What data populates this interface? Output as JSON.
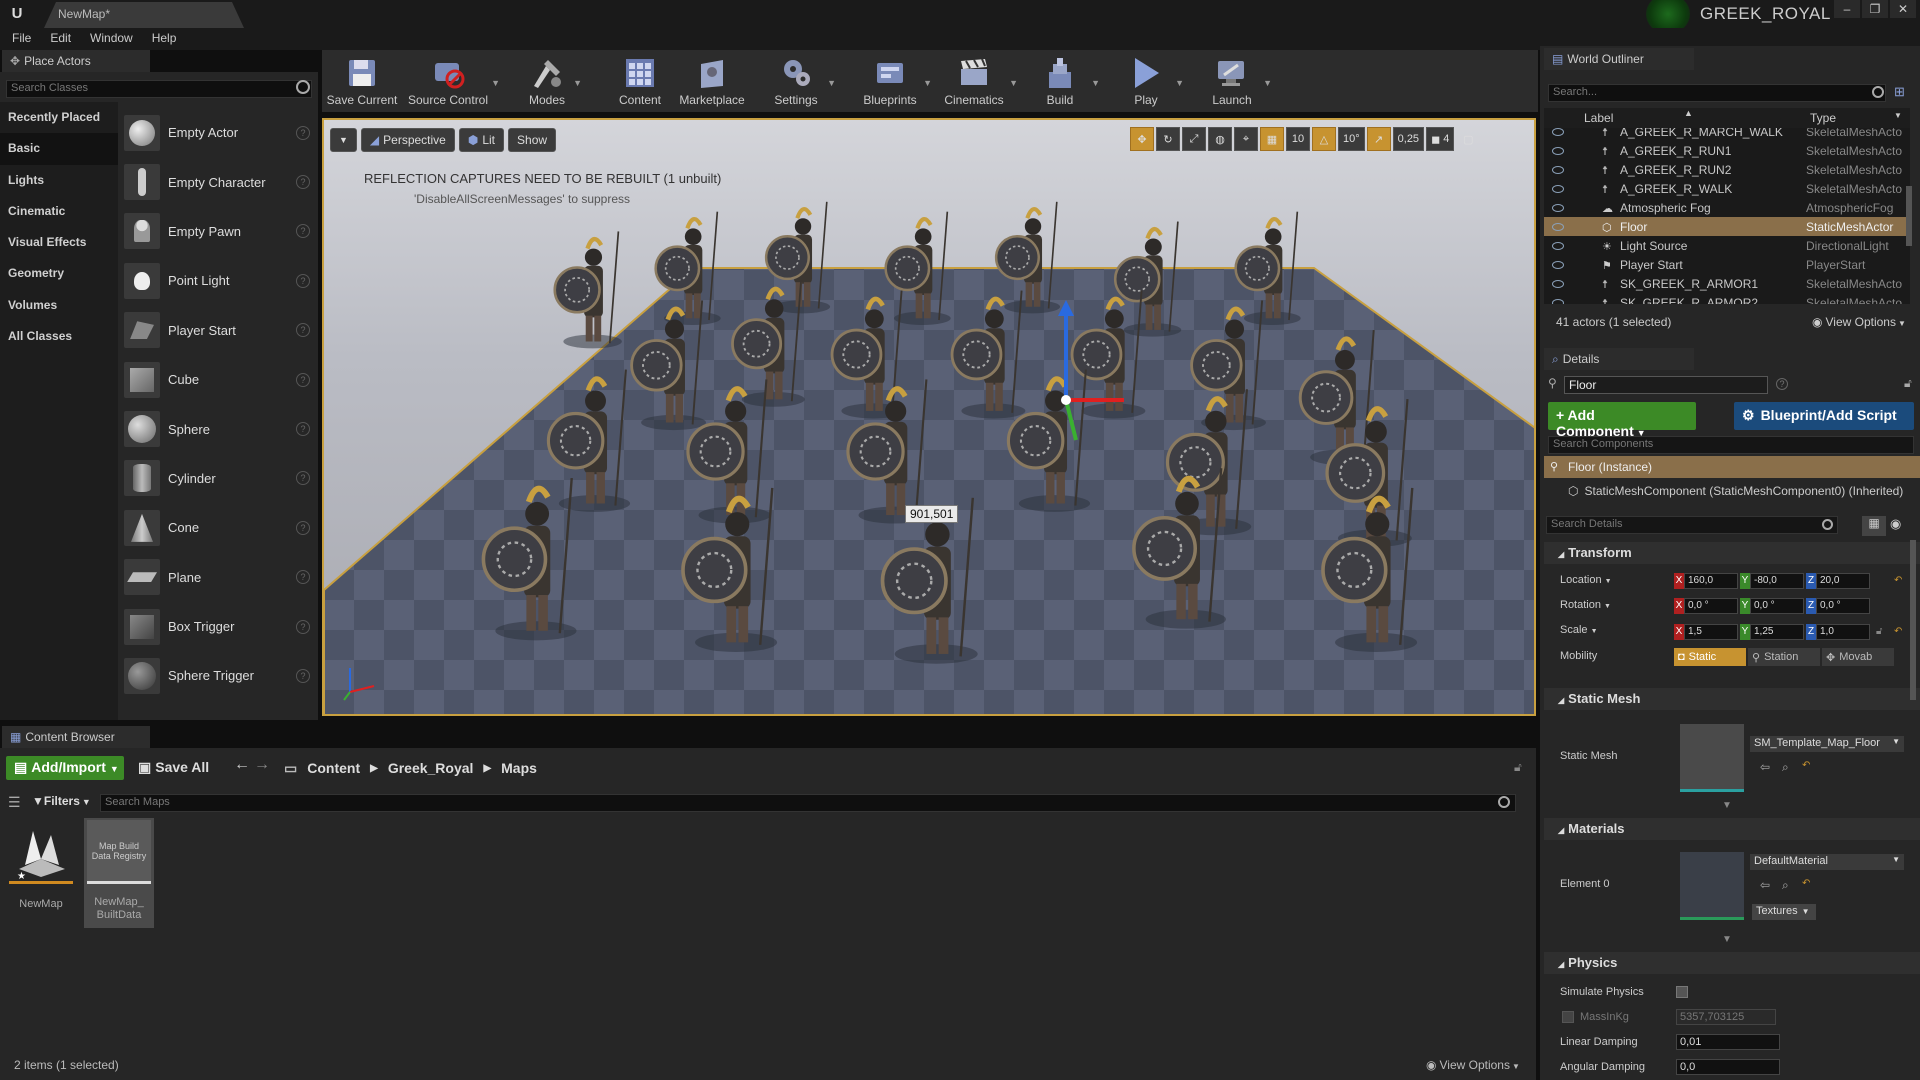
{
  "window": {
    "doc_tab": "NewMap*",
    "project_name": "GREEK_ROYAL",
    "buttons": [
      "‒",
      "❐",
      "✕"
    ]
  },
  "menu": [
    "File",
    "Edit",
    "Window",
    "Help"
  ],
  "place_actors": {
    "tab_title": "Place Actors",
    "search_placeholder": "Search Classes",
    "categories": [
      {
        "label": "Recently Placed",
        "selected": false
      },
      {
        "label": "Basic",
        "selected": true
      },
      {
        "label": "Lights",
        "selected": false
      },
      {
        "label": "Cinematic",
        "selected": false
      },
      {
        "label": "Visual Effects",
        "selected": false
      },
      {
        "label": "Geometry",
        "selected": false
      },
      {
        "label": "Volumes",
        "selected": false
      },
      {
        "label": "All Classes",
        "selected": false
      }
    ],
    "actors": [
      {
        "label": "Empty Actor",
        "icon": "sphere-icon"
      },
      {
        "label": "Empty Character",
        "icon": "character-icon"
      },
      {
        "label": "Empty Pawn",
        "icon": "pawn-icon"
      },
      {
        "label": "Point Light",
        "icon": "light-bulb-icon"
      },
      {
        "label": "Player Start",
        "icon": "player-start-icon"
      },
      {
        "label": "Cube",
        "icon": "cube-icon"
      },
      {
        "label": "Sphere",
        "icon": "sphere-icon"
      },
      {
        "label": "Cylinder",
        "icon": "cylinder-icon"
      },
      {
        "label": "Cone",
        "icon": "cone-icon"
      },
      {
        "label": "Plane",
        "icon": "plane-icon"
      },
      {
        "label": "Box Trigger",
        "icon": "box-trigger-icon"
      },
      {
        "label": "Sphere Trigger",
        "icon": "sphere-trigger-icon"
      }
    ]
  },
  "toolbar": [
    {
      "label": "Save Current",
      "icon": "save-icon",
      "caret": false
    },
    {
      "label": "Source Control",
      "icon": "source-control-icon",
      "caret": true
    },
    {
      "label": "Modes",
      "icon": "modes-icon",
      "caret": true
    },
    {
      "label": "Content",
      "icon": "content-icon",
      "caret": false
    },
    {
      "label": "Marketplace",
      "icon": "marketplace-icon",
      "caret": false
    },
    {
      "label": "Settings",
      "icon": "settings-icon",
      "caret": true
    },
    {
      "label": "Blueprints",
      "icon": "blueprints-icon",
      "caret": true
    },
    {
      "label": "Cinematics",
      "icon": "cinematics-icon",
      "caret": true
    },
    {
      "label": "Build",
      "icon": "build-icon",
      "caret": true
    },
    {
      "label": "Play",
      "icon": "play-icon",
      "caret": true
    },
    {
      "label": "Launch",
      "icon": "launch-icon",
      "caret": true
    }
  ],
  "viewport": {
    "perspective": "Perspective",
    "lit": "Lit",
    "show": "Show",
    "grid_snap": "10",
    "rot_snap": "10°",
    "scale_snap": "0,25",
    "camera_speed": "4",
    "warning": "REFLECTION CAPTURES NEED TO BE REBUILT (1 unbuilt)",
    "warning_hint": "'DisableAllScreenMessages' to suppress",
    "coord_tag": "901,501"
  },
  "content_browser": {
    "tab_title": "Content Browser",
    "add_import": "Add/Import",
    "save_all": "Save All",
    "path": [
      "Content",
      "Greek_Royal",
      "Maps"
    ],
    "filters": "Filters",
    "search_placeholder": "Search Maps",
    "assets": [
      {
        "name": "NewMap",
        "thumb_label": "",
        "selected": false
      },
      {
        "name": "NewMap_\nBuiltData",
        "thumb_label": "Map Build Data Registry",
        "selected": true
      }
    ],
    "status": "2 items (1 selected)",
    "view_options": "View Options"
  },
  "world_outliner": {
    "tab_title": "World Outliner",
    "search_placeholder": "Search...",
    "col_label": "Label",
    "col_type": "Type",
    "rows": [
      {
        "label": "A_GREEK_R_MARCH_WALK",
        "type": "SkeletalMeshActo",
        "selected": false
      },
      {
        "label": "A_GREEK_R_RUN1",
        "type": "SkeletalMeshActo",
        "selected": false
      },
      {
        "label": "A_GREEK_R_RUN2",
        "type": "SkeletalMeshActo",
        "selected": false
      },
      {
        "label": "A_GREEK_R_WALK",
        "type": "SkeletalMeshActo",
        "selected": false
      },
      {
        "label": "Atmospheric Fog",
        "type": "AtmosphericFog",
        "selected": false
      },
      {
        "label": "Floor",
        "type": "StaticMeshActor",
        "selected": true
      },
      {
        "label": "Light Source",
        "type": "DirectionalLight",
        "selected": false
      },
      {
        "label": "Player Start",
        "type": "PlayerStart",
        "selected": false
      },
      {
        "label": "SK_GREEK_R_ARMOR1",
        "type": "SkeletalMeshActo",
        "selected": false
      },
      {
        "label": "SK_GREEK_R_ARMOR2",
        "type": "SkeletalMeshActo",
        "selected": false
      }
    ],
    "count": "41 actors (1 selected)",
    "view_options": "View Options"
  },
  "details": {
    "tab_title": "Details",
    "name": "Floor",
    "add_component": "Add Component",
    "blueprint_script": "Blueprint/Add Script",
    "search_components": "Search Components",
    "instance": "Floor (Instance)",
    "mesh_component": "StaticMeshComponent (StaticMeshComponent0) (Inherited)",
    "search_details": "Search Details",
    "transform": {
      "title": "Transform",
      "location_label": "Location",
      "rotation_label": "Rotation",
      "scale_label": "Scale",
      "mobility_label": "Mobility",
      "location": [
        "160,0",
        "-80,0",
        "20,0"
      ],
      "rotation": [
        "0,0 °",
        "0,0 °",
        "0,0 °"
      ],
      "scale": [
        "1,5",
        "1,25",
        "1,0"
      ],
      "mobility": [
        "Static",
        "Station",
        "Movab"
      ]
    },
    "static_mesh": {
      "title": "Static Mesh",
      "label": "Static Mesh",
      "value": "SM_Template_Map_Floor"
    },
    "materials": {
      "title": "Materials",
      "label": "Element 0",
      "value": "DefaultMaterial",
      "textures": "Textures"
    },
    "physics": {
      "title": "Physics",
      "simulate_label": "Simulate Physics",
      "mass_label": "MassInKg",
      "mass_value": "5357,703125",
      "linear_label": "Linear Damping",
      "linear_value": "0,01",
      "angular_label": "Angular Damping",
      "angular_value": "0,0"
    }
  },
  "colors": {
    "accent_orange": "#c79330",
    "add_green": "#3c8a26",
    "blueprint_blue": "#1b4b7c",
    "selected_row": "#8a6f4a"
  }
}
